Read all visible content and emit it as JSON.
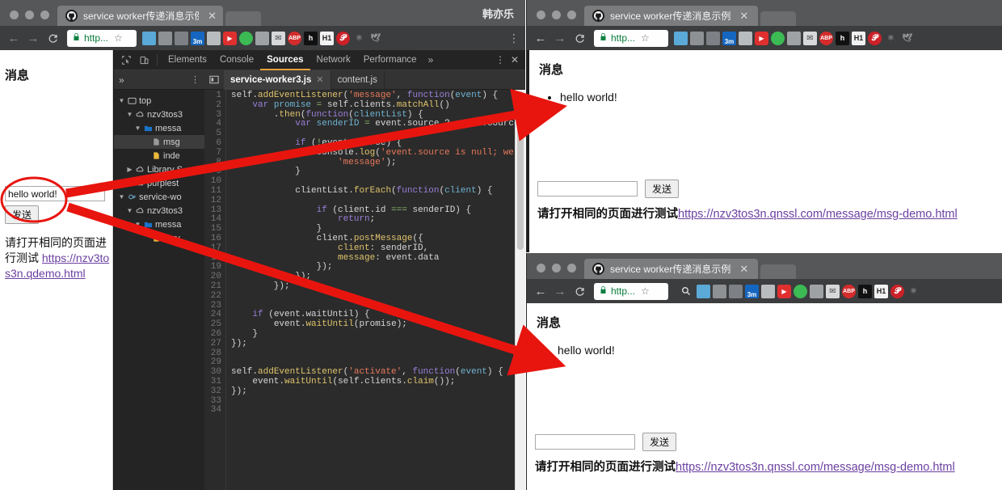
{
  "brand": {
    "accent": "#e8a33d",
    "annotation": "#e8150f",
    "link": "#6b3fa0",
    "secure_green": "#0b8043"
  },
  "windows": {
    "left": {
      "tab": {
        "title": "service worker传递消息示例",
        "favicon": "github-icon",
        "close": "✕"
      },
      "user": "韩亦乐",
      "toolbar": {
        "back": "←",
        "forward": "→",
        "reload": "C",
        "url": "http...",
        "lock": "🔒",
        "star": "☆",
        "menu": "⋮"
      },
      "page": {
        "heading": "消息",
        "input_value": "hello world!",
        "input_placeholder": "",
        "send_label": "发送",
        "hint_text": "请打开相同的页面进行测试",
        "hint_link": "https://nzv3tos3n.q",
        "hint_link_2": "demo.html"
      }
    },
    "right_top": {
      "tab": {
        "title": "service worker传递消息示例",
        "favicon": "github-icon",
        "close": "✕"
      },
      "toolbar": {
        "back": "←",
        "forward": "→",
        "reload": "C",
        "url": "http...",
        "lock": "🔒",
        "star": "☆"
      },
      "page": {
        "heading": "消息",
        "messages": [
          "hello world!"
        ],
        "input_value": "",
        "input_placeholder": "",
        "send_label": "发送",
        "hint_text": "请打开相同的页面进行测试",
        "hint_link": "https://nzv3tos3n.qnssl.com/message/msg-demo.html"
      }
    },
    "right_bottom": {
      "tab": {
        "title": "service worker传递消息示例",
        "favicon": "github-icon",
        "close": "✕"
      },
      "toolbar": {
        "back": "←",
        "forward": "→",
        "reload": "C",
        "url": "http...",
        "lock": "🔒",
        "star": "☆",
        "search": "search-icon"
      },
      "page": {
        "heading": "消息",
        "messages": [
          "hello world!"
        ],
        "input_value": "",
        "input_placeholder": "",
        "send_label": "发送",
        "hint_text": "请打开相同的页面进行测试",
        "hint_link": "https://nzv3tos3n.qnssl.com/message/msg-demo.html"
      }
    }
  },
  "extensions": [
    {
      "name": "pocket-icon",
      "glyph": "",
      "bg": "#5aa9d6",
      "fg": "#ffffff"
    },
    {
      "name": "globe-icon",
      "glyph": "",
      "bg": "#8e9194",
      "fg": "#ffffff"
    },
    {
      "name": "pin-icon",
      "glyph": "",
      "bg": "#7d8084",
      "fg": "#ffffff"
    },
    {
      "name": "3m-icon",
      "glyph": "3m",
      "bg": "#1566c0",
      "fg": "#ffffff"
    },
    {
      "name": "screenshot-icon",
      "glyph": "",
      "bg": "#b9bcbf",
      "fg": "#555555"
    },
    {
      "name": "youtube-icon",
      "glyph": "▶",
      "bg": "#e02f2f",
      "fg": "#ffffff"
    },
    {
      "name": "chrome-icon",
      "glyph": "",
      "bg": "#3cba54",
      "fg": "#ffffff"
    },
    {
      "name": "evernote-icon",
      "glyph": "",
      "bg": "#9fa2a5",
      "fg": "#ffffff"
    },
    {
      "name": "mail-icon",
      "glyph": "✉",
      "bg": "#d6d8da",
      "fg": "#4a4a4a"
    },
    {
      "name": "adblock-icon",
      "glyph": "ABP",
      "bg": "#d42c2c",
      "fg": "#ffffff"
    },
    {
      "name": "hypothesis-icon",
      "glyph": "h",
      "bg": "#111111",
      "fg": "#ffffff"
    },
    {
      "name": "headings-icon",
      "glyph": "H1",
      "bg": "#f2f2f2",
      "fg": "#222222"
    },
    {
      "name": "pinterest-icon",
      "glyph": "𝓟",
      "bg": "#cc2127",
      "fg": "#ffffff"
    },
    {
      "name": "react-icon",
      "glyph": "⚛",
      "bg": "transparent",
      "fg": "#b9bcbf"
    },
    {
      "name": "bird-icon",
      "glyph": "🕊",
      "bg": "transparent",
      "fg": "#9a9d9f"
    }
  ],
  "devtools": {
    "panel_tabs": [
      "Elements",
      "Console",
      "Sources",
      "Network",
      "Performance"
    ],
    "selected_tab": "Sources",
    "overflow": "»",
    "menu": "⋮",
    "close": "✕",
    "file_tabs": [
      {
        "label": "service-worker3.js",
        "selected": true,
        "close": "✕"
      },
      {
        "label": "content.js",
        "selected": false,
        "close": ""
      }
    ],
    "nav_overflow": "»",
    "nav_menu": "⋮",
    "tree": [
      {
        "indent": 0,
        "twisty": "▼",
        "icon": "frame-icon",
        "label": "top",
        "selected": false
      },
      {
        "indent": 1,
        "twisty": "▼",
        "icon": "cloud-icon",
        "label": "nzv3tos3",
        "selected": false
      },
      {
        "indent": 2,
        "twisty": "▼",
        "icon": "folder-icon",
        "label": "messa",
        "selected": false
      },
      {
        "indent": 3,
        "twisty": "",
        "icon": "file-icon",
        "label": "msg",
        "selected": true
      },
      {
        "indent": 3,
        "twisty": "",
        "icon": "html-icon",
        "label": "inde",
        "selected": false
      },
      {
        "indent": 1,
        "twisty": "▶",
        "icon": "cloud-icon",
        "label": "Library S",
        "selected": false
      },
      {
        "indent": 1,
        "twisty": "▶",
        "icon": "cloud-icon",
        "label": "purplest",
        "selected": false
      },
      {
        "indent": 0,
        "twisty": "▼",
        "icon": "gear-icon",
        "label": "service-wo",
        "selected": false
      },
      {
        "indent": 1,
        "twisty": "▼",
        "icon": "cloud-icon",
        "label": "nzv3tos3",
        "selected": false
      },
      {
        "indent": 2,
        "twisty": "▼",
        "icon": "folder-icon",
        "label": "messa",
        "selected": false
      },
      {
        "indent": 3,
        "twisty": "",
        "icon": "js-icon",
        "label": "serv",
        "selected": false
      }
    ],
    "line_count": 34,
    "code_lines": [
      "",
      "self.addEventListener('message', function(event) {",
      "    var promise = self.clients.matchAll()",
      "        .then(function(clientList) {",
      "            var senderID = event.source ? event.source.id : null;",
      "",
      "            if (!event.source) {",
      "                console.log('event.source is null; we do",
      "                    'message');",
      "            }",
      "",
      "            clientList.forEach(function(client) {",
      "",
      "                if (client.id === senderID) {",
      "                    return;",
      "                }",
      "                client.postMessage({",
      "                    client: senderID,",
      "                    message: event.data",
      "                });",
      "            });",
      "        });",
      "",
      "",
      "    if (event.waitUntil) {",
      "        event.waitUntil(promise);",
      "    }",
      "});",
      "",
      "",
      "self.addEventListener('activate', function(event) {",
      "    event.waitUntil(self.clients.claim());",
      "});",
      ""
    ]
  },
  "annotations": {
    "ellipse_label": "highlight-ellipse-around-send-form",
    "arrow1_label": "arrow-to-top-right-message",
    "arrow2_label": "arrow-to-bottom-right-message"
  }
}
